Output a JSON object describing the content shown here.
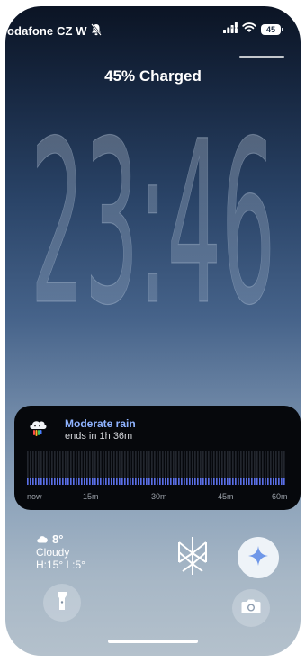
{
  "status_bar": {
    "carrier": "odafone CZ W",
    "battery_level": "45"
  },
  "lock_screen": {
    "charge_text": "45% Charged",
    "time": "23:46"
  },
  "rain_widget": {
    "title": "Moderate rain",
    "subtitle": "ends in 1h 36m",
    "axis_labels": [
      "now",
      "15m",
      "30m",
      "45m",
      "60m"
    ],
    "accent_color": "#8fb3ff",
    "bar_color": "#5a6fe6"
  },
  "weather": {
    "temperature": "8°",
    "condition": "Cloudy",
    "high_low": "H:15° L:5°",
    "icon": "cloud-icon"
  },
  "shortcuts": {
    "left": "flashlight-icon",
    "right": "camera-icon"
  }
}
